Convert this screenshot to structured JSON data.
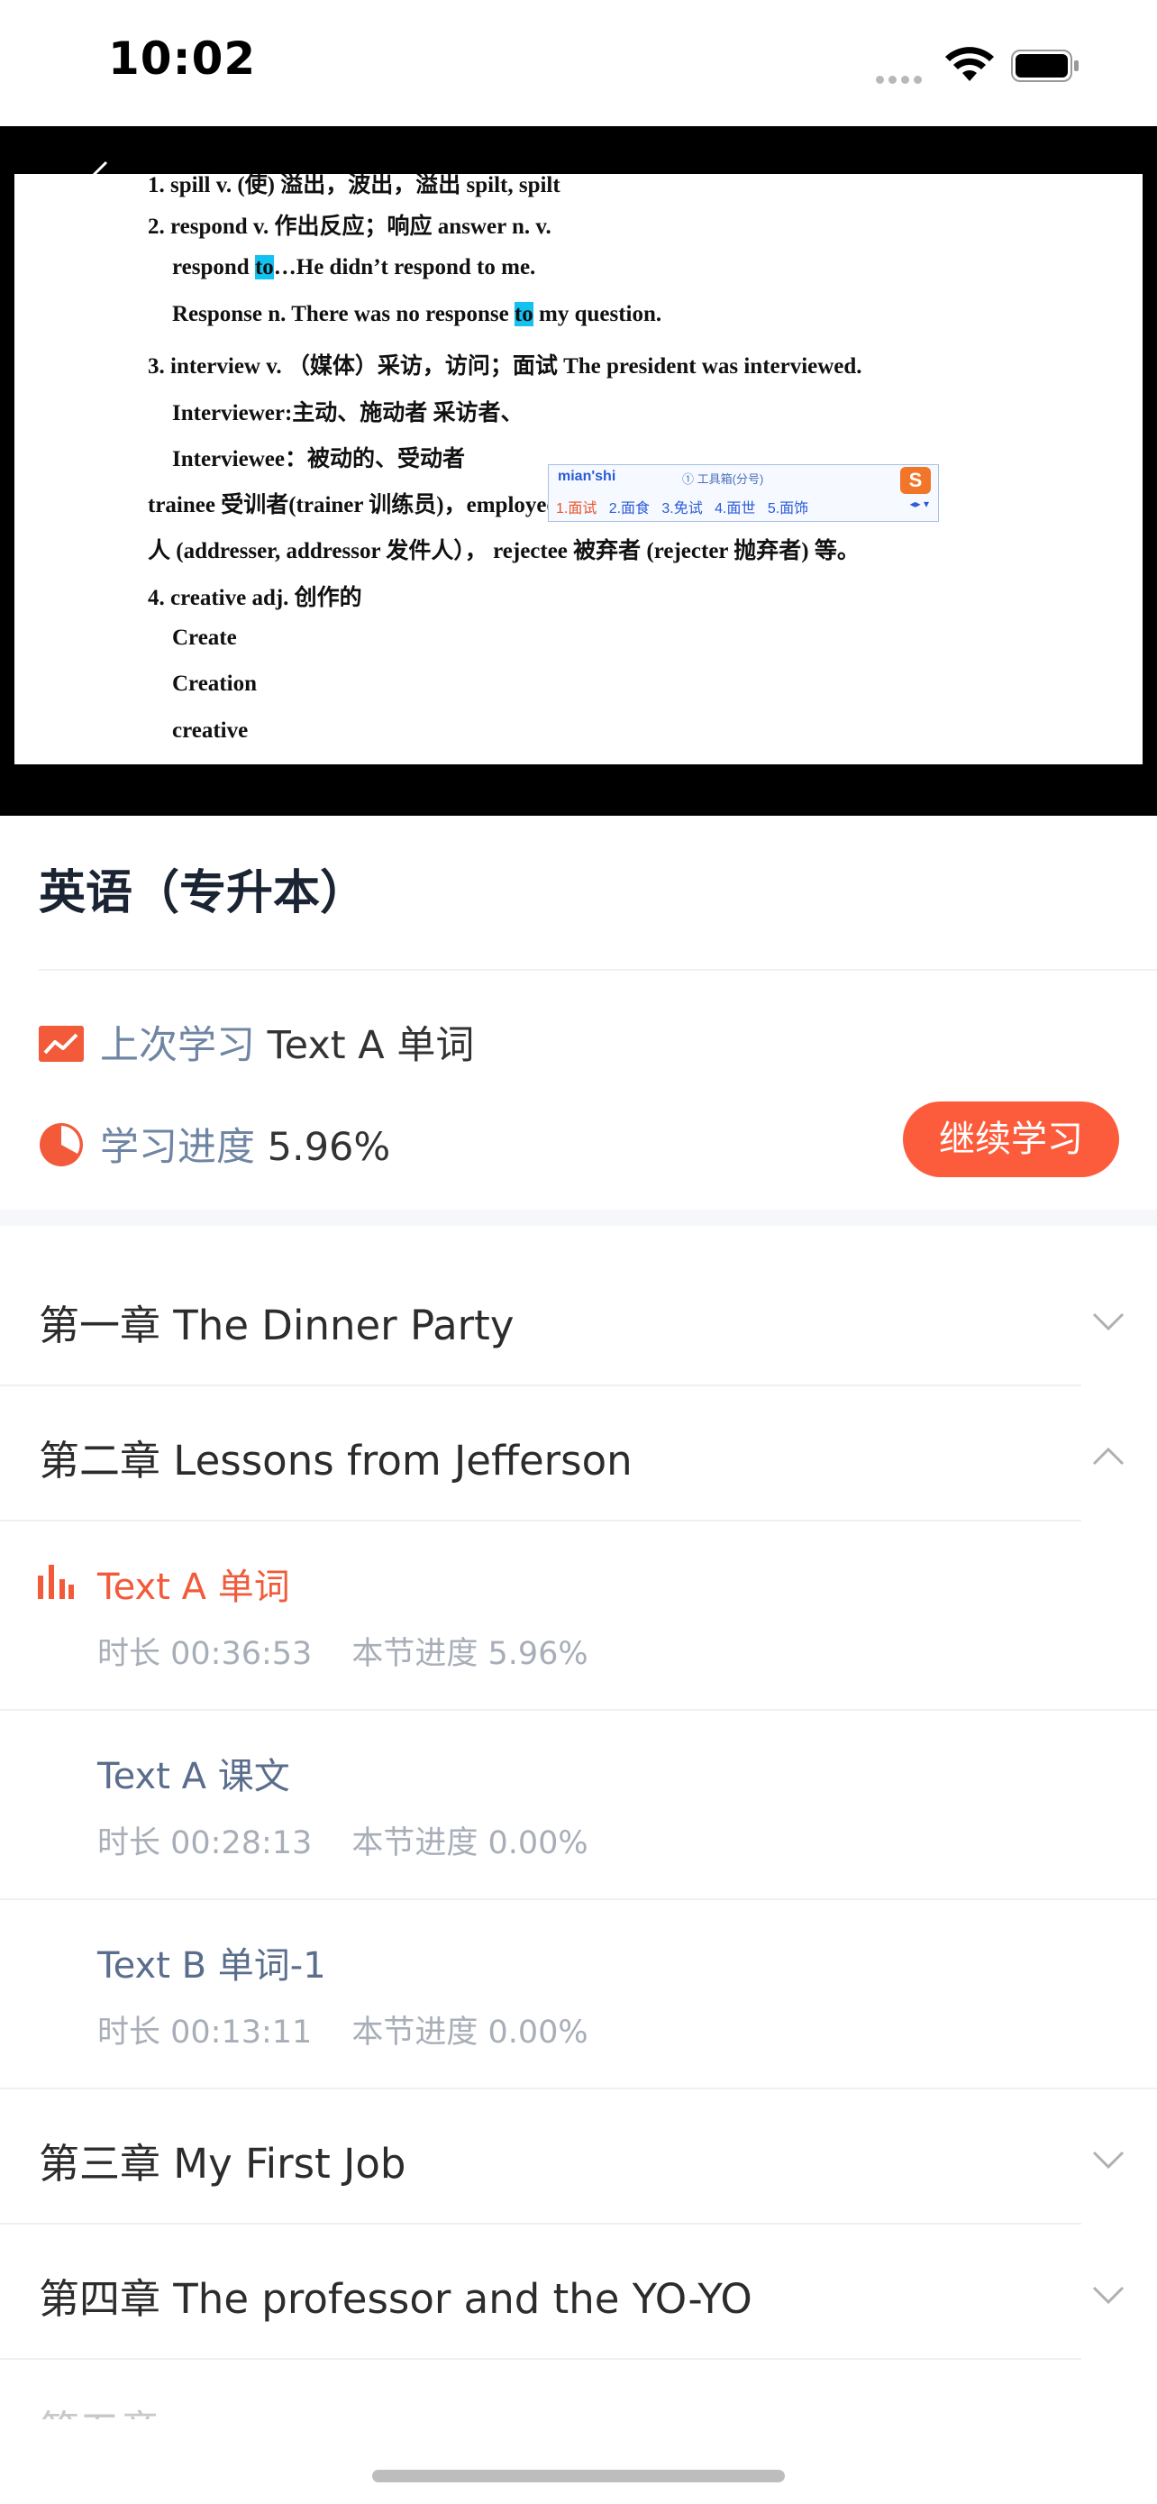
{
  "status": {
    "time": "10:02"
  },
  "video_slide": {
    "lines": [
      "1. spill v. (使) 溢出，波出，溢出  spilt, spilt",
      "2. respond v.  作出反应；响应   answer n. v.",
      "respond ",
      "to",
      "…He didn’t respond to me.",
      "Response n. There was no response ",
      "to",
      " my question.",
      "3.  interview v.  （媒体）采访，访问；面试  The president was interviewed.",
      "Interviewer:主动、施动者  采访者、",
      "Interviewee：被动的、受动者",
      "trainee 受训者(trainer 训练员)，employee 雇员(employer 雇主)，addressee 收件",
      "人  (addresser, addressor 发件人）， rejectee 被弃者  (rejecter 抛弃者)  等。",
      "4.  creative adj.  创作的",
      "Create",
      "Creation",
      "creative"
    ],
    "ime": {
      "pinyin": "mian'shi",
      "toolbox": "① 工具箱(分号)",
      "candidates": [
        "1.面试",
        "2.面食",
        "3.免试",
        "4.面世",
        "5.面饰"
      ]
    }
  },
  "course": {
    "title": "英语（专升本）",
    "last_study_label": "上次学习",
    "last_study_value": "Text A 单词",
    "progress_label": "学习进度",
    "progress_value": "5.96%",
    "continue_label": "继续学习"
  },
  "chapters": [
    {
      "title": "第一章 The Dinner Party",
      "expanded": false
    },
    {
      "title": "第二章 Lessons from Jefferson",
      "expanded": true
    },
    {
      "title": "第三章 My First Job",
      "expanded": false
    },
    {
      "title": "第四章 The professor and the YO-YO",
      "expanded": false
    }
  ],
  "lessons": [
    {
      "name": "Text A 单词",
      "duration": "时长 00:36:53",
      "progress": "本节进度 5.96%",
      "active": true
    },
    {
      "name": "Text A  课文",
      "duration": "时长 00:28:13",
      "progress": "本节进度 0.00%",
      "active": false
    },
    {
      "name": "Text B  单词-1",
      "duration": "时长 00:13:11",
      "progress": "本节进度 0.00%",
      "active": false
    }
  ],
  "partial_chapter_text": "第五章",
  "colors": {
    "accent": "#fd5c3c",
    "label": "#6f85a3",
    "meta": "#a8aeb8"
  }
}
